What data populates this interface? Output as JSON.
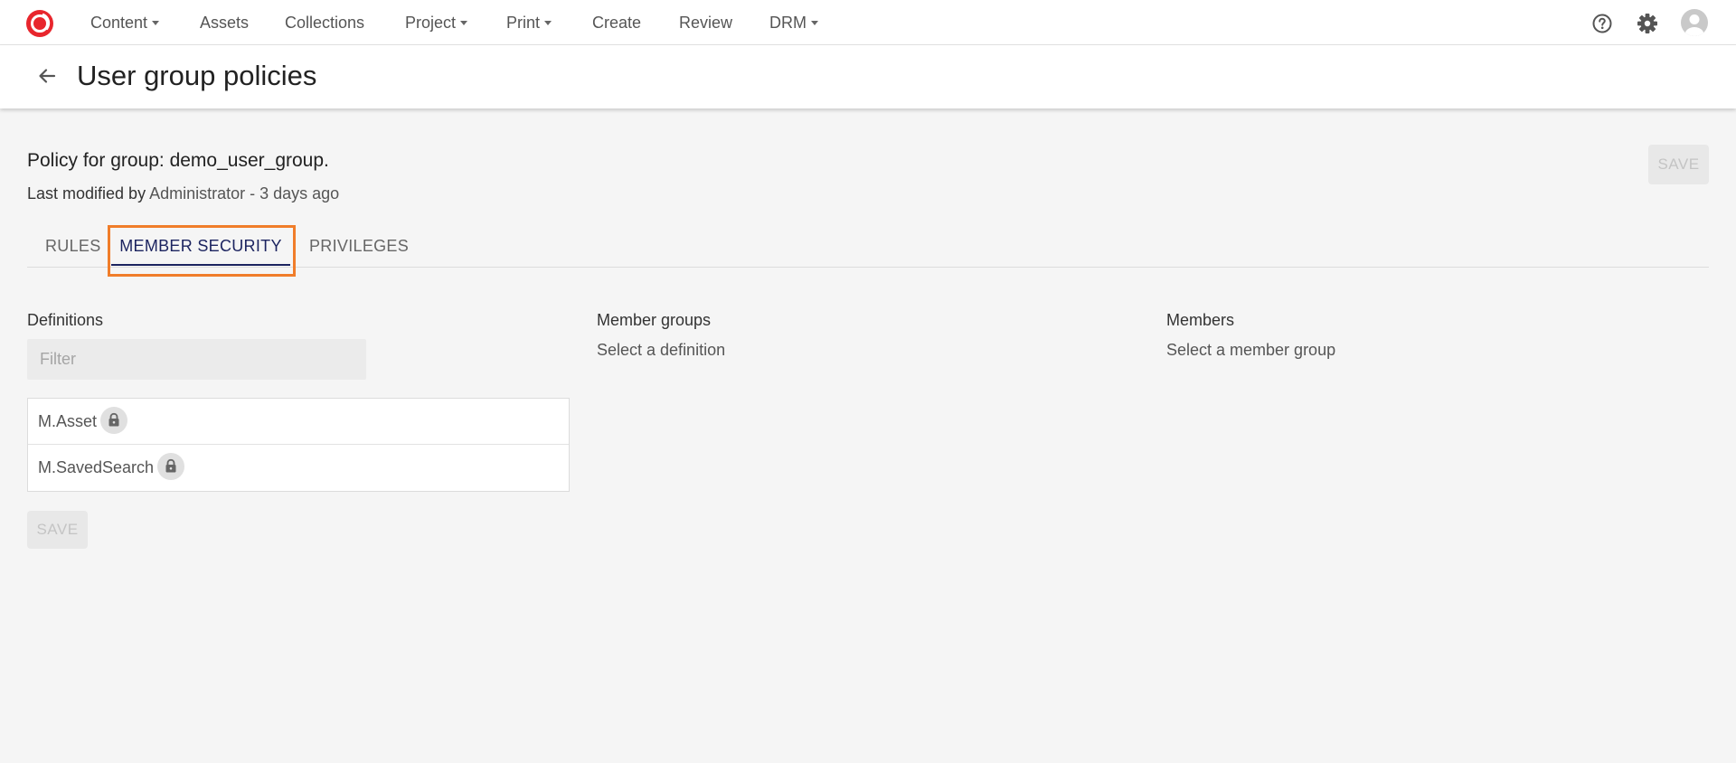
{
  "nav": {
    "items": [
      {
        "label": "Content",
        "dropdown": true
      },
      {
        "label": "Assets",
        "dropdown": false
      },
      {
        "label": "Collections",
        "dropdown": false
      },
      {
        "label": "Project",
        "dropdown": true
      },
      {
        "label": "Print",
        "dropdown": true
      },
      {
        "label": "Create",
        "dropdown": false
      },
      {
        "label": "Review",
        "dropdown": false
      },
      {
        "label": "DRM",
        "dropdown": true
      }
    ],
    "icons": [
      "help-icon",
      "gear-icon",
      "user-avatar-icon"
    ],
    "logo_icon": "app-logo-icon",
    "brand_color": "#e8262d"
  },
  "header": {
    "title": "User group policies",
    "back_icon": "arrow-left-icon"
  },
  "policy": {
    "heading": "Policy for group: demo_user_group.",
    "last_modified_label": "Last modified by",
    "last_modified_value": "Administrator - 3 days ago",
    "save_label": "SAVE"
  },
  "tabs": {
    "items": [
      "RULES",
      "MEMBER SECURITY",
      "PRIVILEGES"
    ],
    "active": "MEMBER SECURITY",
    "active_color": "#1c2460",
    "highlight_color": "#f07d2a"
  },
  "definitions": {
    "title": "Definitions",
    "filter_placeholder": "Filter",
    "filter_value": "",
    "items": [
      {
        "label": "M.Asset",
        "icon": "lock-icon"
      },
      {
        "label": "M.SavedSearch",
        "icon": "lock-icon"
      }
    ],
    "save_label": "SAVE"
  },
  "member_groups": {
    "title": "Member groups",
    "placeholder_text": "Select a definition"
  },
  "members": {
    "title": "Members",
    "placeholder_text": "Select a member group"
  }
}
